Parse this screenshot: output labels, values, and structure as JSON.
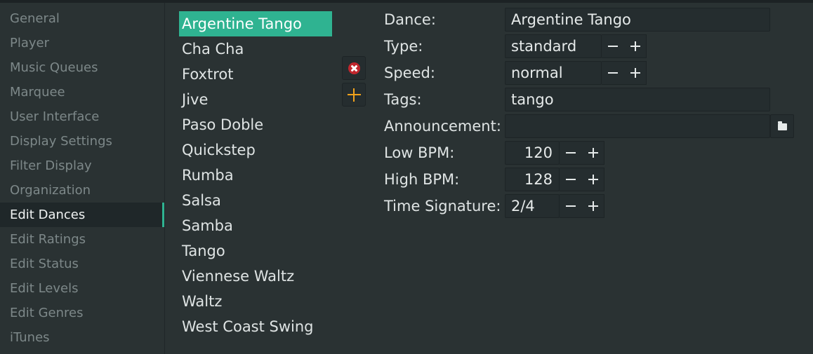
{
  "sidebar": {
    "items": [
      {
        "label": "General"
      },
      {
        "label": "Player"
      },
      {
        "label": "Music Queues"
      },
      {
        "label": "Marquee"
      },
      {
        "label": "User Interface"
      },
      {
        "label": "Display Settings"
      },
      {
        "label": "Filter Display"
      },
      {
        "label": "Organization"
      },
      {
        "label": "Edit Dances"
      },
      {
        "label": "Edit Ratings"
      },
      {
        "label": "Edit Status"
      },
      {
        "label": "Edit Levels"
      },
      {
        "label": "Edit Genres"
      },
      {
        "label": "iTunes"
      }
    ],
    "active": "Edit Dances"
  },
  "dances": {
    "items": [
      {
        "label": "Argentine Tango"
      },
      {
        "label": "Cha Cha"
      },
      {
        "label": "Foxtrot"
      },
      {
        "label": "Jive"
      },
      {
        "label": "Paso Doble"
      },
      {
        "label": "Quickstep"
      },
      {
        "label": "Rumba"
      },
      {
        "label": "Salsa"
      },
      {
        "label": "Samba"
      },
      {
        "label": "Tango"
      },
      {
        "label": "Viennese Waltz"
      },
      {
        "label": "Waltz"
      },
      {
        "label": "West Coast Swing"
      }
    ],
    "selected": "Argentine Tango",
    "remove_icon": "remove-icon",
    "add_icon": "add-icon"
  },
  "form": {
    "dance_label": "Dance:",
    "dance_value": "Argentine Tango",
    "type_label": "Type:",
    "type_value": "standard",
    "speed_label": "Speed:",
    "speed_value": "normal",
    "tags_label": "Tags:",
    "tags_value": "tango",
    "announcement_label": "Announcement:",
    "announcement_value": "",
    "low_bpm_label": "Low BPM:",
    "low_bpm_value": "120",
    "high_bpm_label": "High BPM:",
    "high_bpm_value": "128",
    "time_signature_label": "Time Signature:",
    "time_signature_value": "2/4",
    "browse_icon": "folder-icon"
  },
  "colors": {
    "background": "#2a3233",
    "accent": "#2fb391",
    "remove": "#c0262d",
    "add": "#f2a21b",
    "muted_text": "#7d8889"
  }
}
